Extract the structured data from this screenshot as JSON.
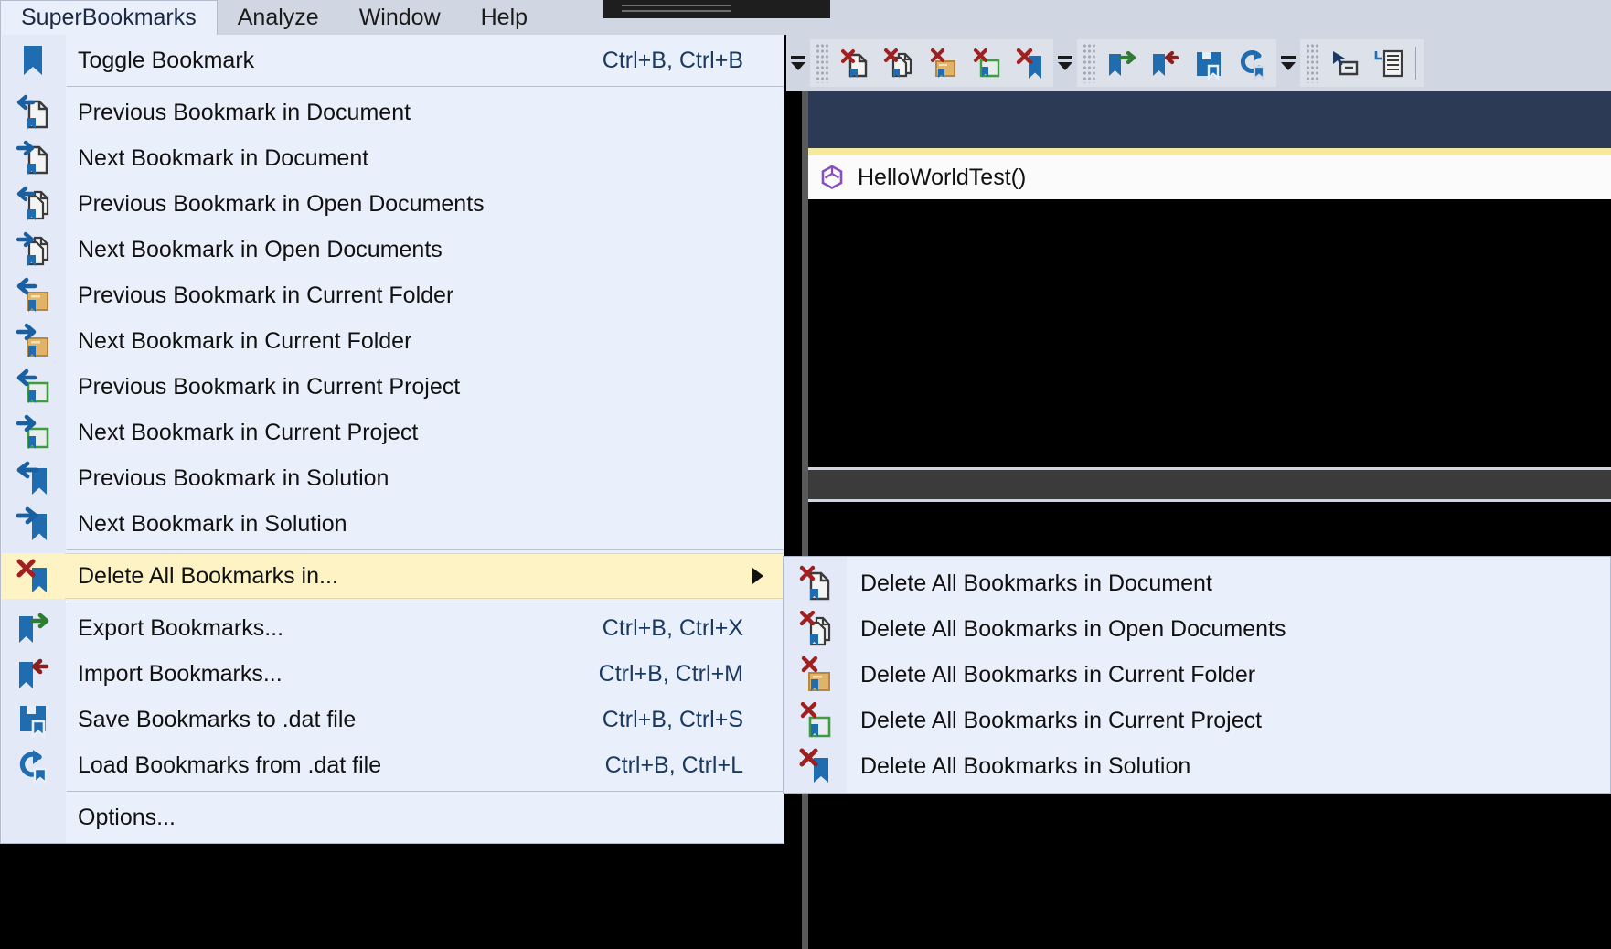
{
  "menubar": {
    "items": [
      {
        "label": "SuperBookmarks",
        "active": true
      },
      {
        "label": "Analyze",
        "active": false
      },
      {
        "label": "Window",
        "active": false
      },
      {
        "label": "Help",
        "active": false
      }
    ]
  },
  "menu": {
    "items": [
      {
        "label": "Toggle Bookmark",
        "accel": "Ctrl+B, Ctrl+B",
        "icon": "bookmark-icon",
        "sep_after": true
      },
      {
        "label": "Previous Bookmark in Document",
        "accel": "",
        "icon": "prev-bookmark-document-icon"
      },
      {
        "label": "Next Bookmark in Document",
        "accel": "",
        "icon": "next-bookmark-document-icon"
      },
      {
        "label": "Previous Bookmark in Open Documents",
        "accel": "",
        "icon": "prev-bookmark-open-documents-icon"
      },
      {
        "label": "Next Bookmark in Open Documents",
        "accel": "",
        "icon": "next-bookmark-open-documents-icon"
      },
      {
        "label": "Previous Bookmark in Current Folder",
        "accel": "",
        "icon": "prev-bookmark-folder-icon"
      },
      {
        "label": "Next Bookmark in Current Folder",
        "accel": "",
        "icon": "next-bookmark-folder-icon"
      },
      {
        "label": "Previous Bookmark in Current Project",
        "accel": "",
        "icon": "prev-bookmark-project-icon"
      },
      {
        "label": "Next Bookmark in Current Project",
        "accel": "",
        "icon": "next-bookmark-project-icon"
      },
      {
        "label": "Previous Bookmark in Solution",
        "accel": "",
        "icon": "prev-bookmark-solution-icon"
      },
      {
        "label": "Next Bookmark in Solution",
        "accel": "",
        "icon": "next-bookmark-solution-icon",
        "sep_after": true
      },
      {
        "label": "Delete All Bookmarks in...",
        "accel": "",
        "icon": "delete-all-bookmarks-icon",
        "highlighted": true,
        "submenu": true,
        "sep_after": true
      },
      {
        "label": "Export Bookmarks...",
        "accel": "Ctrl+B, Ctrl+X",
        "icon": "export-bookmarks-icon"
      },
      {
        "label": "Import Bookmarks...",
        "accel": "Ctrl+B, Ctrl+M",
        "icon": "import-bookmarks-icon"
      },
      {
        "label": "Save Bookmarks to .dat file",
        "accel": "Ctrl+B, Ctrl+S",
        "icon": "save-bookmarks-icon"
      },
      {
        "label": "Load Bookmarks from .dat file",
        "accel": "Ctrl+B, Ctrl+L",
        "icon": "load-bookmarks-icon",
        "sep_after": true
      },
      {
        "label": "Options...",
        "accel": "",
        "icon": "none"
      }
    ]
  },
  "submenu": {
    "items": [
      {
        "label": "Delete All Bookmarks in Document",
        "icon": "delete-bookmarks-document-icon"
      },
      {
        "label": "Delete All Bookmarks in Open Documents",
        "icon": "delete-bookmarks-open-documents-icon"
      },
      {
        "label": "Delete All Bookmarks in Current Folder",
        "icon": "delete-bookmarks-folder-icon"
      },
      {
        "label": "Delete All Bookmarks in Current Project",
        "icon": "delete-bookmarks-project-icon"
      },
      {
        "label": "Delete All Bookmarks in Solution",
        "icon": "delete-bookmarks-solution-icon"
      }
    ]
  },
  "toolbar": {
    "groups": [
      {
        "buttons": [
          "delete-bookmarks-document-icon",
          "delete-bookmarks-open-documents-icon",
          "delete-bookmarks-folder-icon",
          "delete-bookmarks-project-icon",
          "delete-bookmarks-solution-icon"
        ]
      },
      {
        "buttons": [
          "export-bookmarks-icon",
          "import-bookmarks-icon",
          "save-bookmarks-icon",
          "load-bookmarks-icon"
        ]
      },
      {
        "buttons": [
          "rename-icon",
          "indent-list-icon"
        ]
      }
    ]
  },
  "editor": {
    "member_label": "HelloWorldTest()",
    "member_icon": "method-cube-icon"
  },
  "colors": {
    "menu_background": "#eaf0fb",
    "menu_gutter": "#e3e9f6",
    "highlight": "#fdf3c4",
    "chrome": "#d0d6e2",
    "accent_blue": "#1f6cb0",
    "delete_red": "#a02020",
    "folder_tan": "#e0b36a",
    "project_green": "#3e9e3e",
    "editor_header": "#2d3a56",
    "yellow_rule": "#f5ea9e"
  }
}
